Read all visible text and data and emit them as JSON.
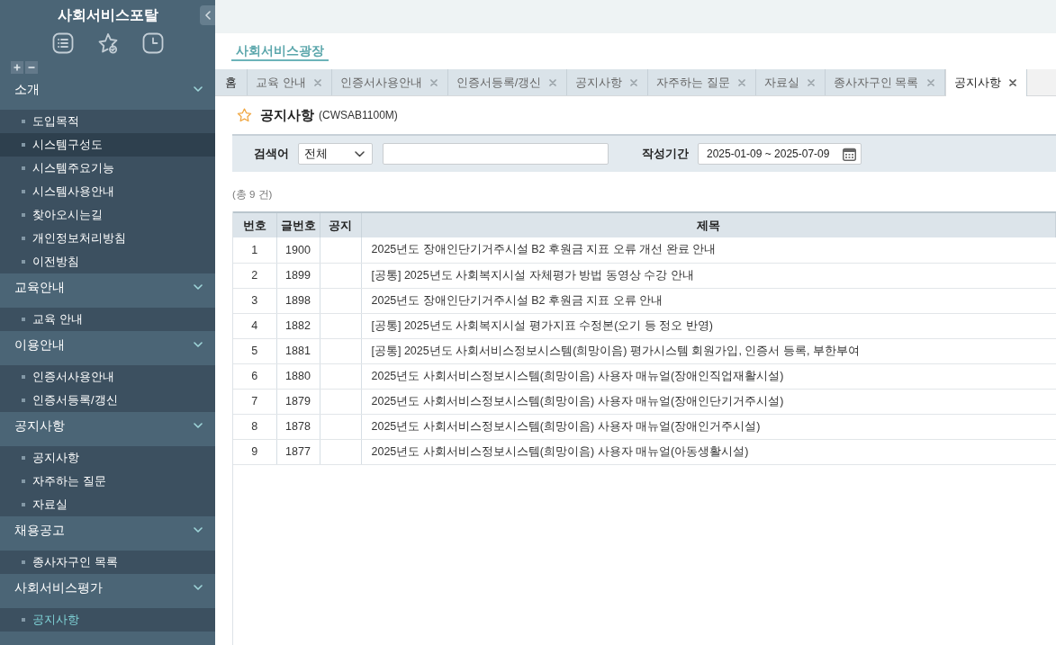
{
  "sidebar": {
    "title": "사회서비스포탈",
    "groups": [
      {
        "label": "소개",
        "expanded": true,
        "items": [
          {
            "label": "도입목적",
            "selected": false,
            "highlighted": false
          },
          {
            "label": "시스템구성도",
            "selected": false,
            "highlighted": true
          },
          {
            "label": "시스템주요기능",
            "selected": false,
            "highlighted": false
          },
          {
            "label": "시스템사용안내",
            "selected": false,
            "highlighted": false
          },
          {
            "label": "찾아오시는길",
            "selected": false,
            "highlighted": false
          },
          {
            "label": "개인정보처리방침",
            "selected": false,
            "highlighted": false
          },
          {
            "label": "이전방침",
            "selected": false,
            "highlighted": false
          }
        ]
      },
      {
        "label": "교육안내",
        "expanded": true,
        "items": [
          {
            "label": "교육 안내",
            "selected": false,
            "highlighted": false
          }
        ]
      },
      {
        "label": "이용안내",
        "expanded": true,
        "items": [
          {
            "label": "인증서사용안내",
            "selected": false,
            "highlighted": false
          },
          {
            "label": "인증서등록/갱신",
            "selected": false,
            "highlighted": false
          }
        ]
      },
      {
        "label": "공지사항",
        "expanded": true,
        "items": [
          {
            "label": "공지사항",
            "selected": false,
            "highlighted": false
          },
          {
            "label": "자주하는 질문",
            "selected": false,
            "highlighted": false
          },
          {
            "label": "자료실",
            "selected": false,
            "highlighted": false
          }
        ]
      },
      {
        "label": "채용공고",
        "expanded": true,
        "items": [
          {
            "label": "종사자구인 목록",
            "selected": false,
            "highlighted": false
          }
        ]
      },
      {
        "label": "사회서비스평가",
        "expanded": true,
        "items": [
          {
            "label": "공지사항",
            "selected": true,
            "highlighted": false
          }
        ]
      }
    ]
  },
  "site_link": {
    "label": "사회서비스광장"
  },
  "tabs": [
    {
      "label": "홈",
      "selected": false,
      "closable": false
    },
    {
      "label": "교육 안내",
      "selected": false,
      "closable": true
    },
    {
      "label": "인증서사용안내",
      "selected": false,
      "closable": true
    },
    {
      "label": "인증서등록/갱신",
      "selected": false,
      "closable": true
    },
    {
      "label": "공지사항",
      "selected": false,
      "closable": true
    },
    {
      "label": "자주하는 질문",
      "selected": false,
      "closable": true
    },
    {
      "label": "자료실",
      "selected": false,
      "closable": true
    },
    {
      "label": "종사자구인 목록",
      "selected": false,
      "closable": true
    },
    {
      "label": "공지사항",
      "selected": true,
      "closable": true
    }
  ],
  "page": {
    "title": "공지사항",
    "code": "(CWSAB1100M)",
    "favorite": false
  },
  "search": {
    "keyword_label": "검색어",
    "category": {
      "value": "전체"
    },
    "period_label": "작성기간",
    "period": {
      "value": "2025-01-09 ~ 2025-07-09"
    }
  },
  "result_count": "(총 9 건)",
  "table": {
    "columns": [
      "번호",
      "글번호",
      "공지",
      "제목"
    ],
    "rows": [
      {
        "no": "1",
        "post_no": "1900",
        "title": "2025년도 장애인단기거주시설 B2 후원금 지표 오류 개선 완료 안내"
      },
      {
        "no": "2",
        "post_no": "1899",
        "title": "[공통] 2025년도 사회복지시설 자체평가 방법 동영상 수강 안내"
      },
      {
        "no": "3",
        "post_no": "1898",
        "title": "2025년도 장애인단기거주시설 B2 후원금 지표 오류 안내"
      },
      {
        "no": "4",
        "post_no": "1882",
        "title": "[공통] 2025년도 사회복지시설 평가지표 수정본(오기 등 정오 반영)"
      },
      {
        "no": "5",
        "post_no": "1881",
        "title": "[공통] 2025년도 사회서비스정보시스템(희망이음) 평가시스템 회원가입, 인증서 등록, 부한부여"
      },
      {
        "no": "6",
        "post_no": "1880",
        "title": "2025년도 사회서비스정보시스템(희망이음) 사용자 매뉴얼(장애인직업재활시설)"
      },
      {
        "no": "7",
        "post_no": "1879",
        "title": "2025년도 사회서비스정보시스템(희망이음) 사용자 매뉴얼(장애인단기거주시설)"
      },
      {
        "no": "8",
        "post_no": "1878",
        "title": "2025년도 사회서비스정보시스템(희망이음) 사용자 매뉴얼(장애인거주시설)"
      },
      {
        "no": "9",
        "post_no": "1877",
        "title": "2025년도 사회서비스정보시스템(희망이음) 사용자 매뉴얼(아동생활시설)"
      }
    ]
  }
}
